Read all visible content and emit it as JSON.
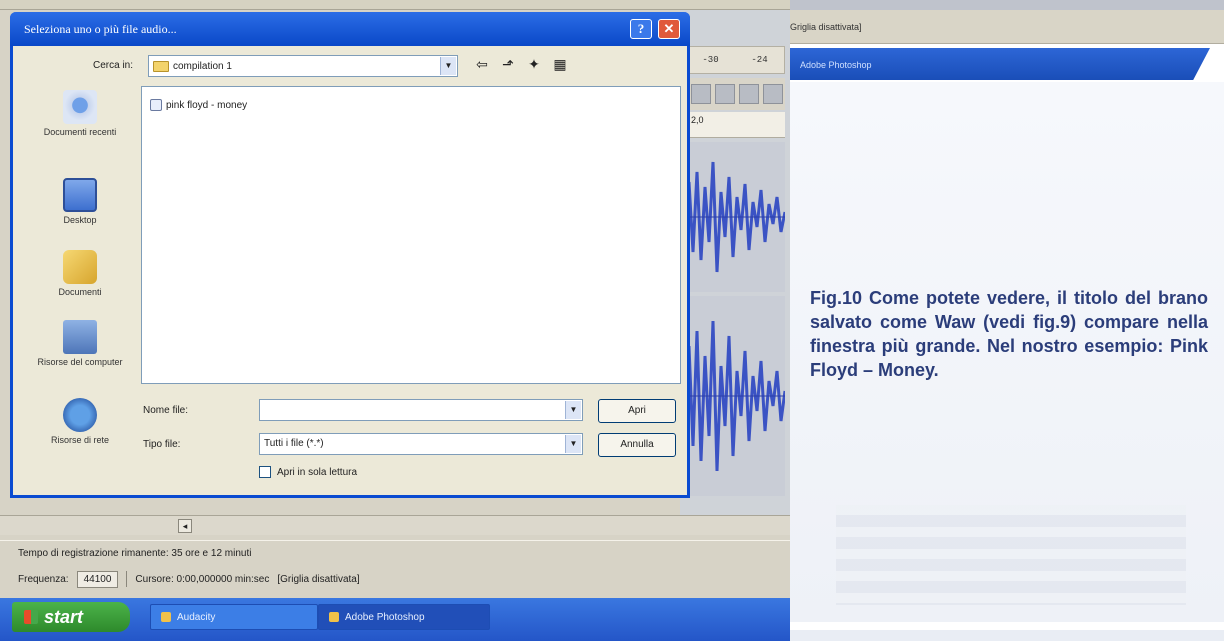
{
  "dialog": {
    "title": "Seleziona uno o più file audio...",
    "help_glyph": "?",
    "close_glyph": "✕",
    "look_in_label": "Cerca in:",
    "look_in_value": "compilation 1",
    "nav_icons": [
      "back-arrow-icon",
      "up-folder-icon",
      "new-folder-icon",
      "view-menu-icon"
    ],
    "places": [
      {
        "label": "Documenti recenti",
        "icon": "recent-documents-icon"
      },
      {
        "label": "Desktop",
        "icon": "desktop-icon"
      },
      {
        "label": "Documenti",
        "icon": "my-documents-icon"
      },
      {
        "label": "Risorse del computer",
        "icon": "my-computer-icon"
      },
      {
        "label": "Risorse di rete",
        "icon": "network-places-icon"
      }
    ],
    "files": [
      {
        "name": "pink floyd - money",
        "icon": "audio-file-icon"
      }
    ],
    "filename_label": "Nome file:",
    "filename_value": "",
    "filetype_label": "Tipo file:",
    "filetype_value": "Tutti i file (*.*)",
    "open_label": "Apri",
    "cancel_label": "Annulla",
    "readonly_label": "Apri in sola lettura"
  },
  "audacity": {
    "meter_labels": [
      "-30",
      "-24"
    ],
    "ruler_value": "2,0",
    "scroll_glyph": "◂",
    "recording_time": "Tempo di registrazione rimanente: 35 ore e 12 minuti",
    "frequency_label": "Frequenza:",
    "frequency_value": "44100",
    "cursor_text": "Cursore: 0:00,000000 min:sec",
    "snap_text": "[Griglia disattivata]"
  },
  "taskbar": {
    "start_label": "start",
    "tasks": [
      "Audacity",
      "Adobe Photoshop"
    ]
  },
  "page": {
    "grid_status": "Griglia disattivata]",
    "photoshop_tab": "Adobe Photoshop",
    "caption": "Fig.10 Come potete vedere, il titolo del brano salvato come Waw (vedi fig.9) compare nella finestra più grande. Nel nostro esempio: Pink Floyd – Money."
  },
  "colors": {
    "xp_blue": "#0a48c8",
    "caption_blue": "#2b3d7a",
    "waveform": "#3b53c4",
    "start_green": "#3a9e3a"
  }
}
